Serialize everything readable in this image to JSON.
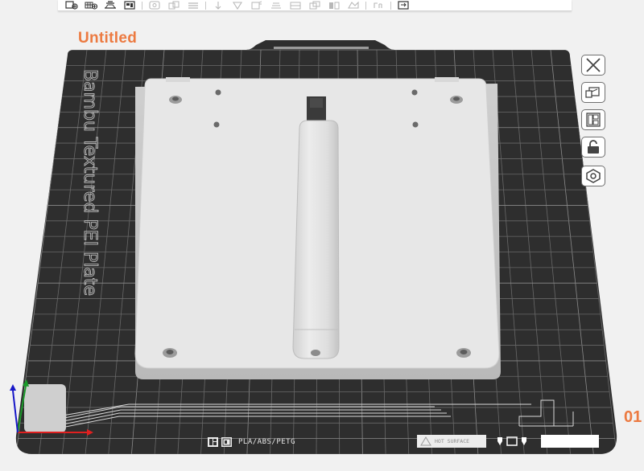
{
  "toolbar": {
    "buttons": [
      {
        "name": "add-object-icon",
        "enabled": true
      },
      {
        "name": "add-plate-icon",
        "enabled": true
      },
      {
        "name": "auto-orient-icon",
        "enabled": true
      },
      {
        "name": "arrange-icon",
        "enabled": true
      },
      {
        "name": "split-objects-icon",
        "enabled": false
      },
      {
        "name": "split-parts-icon",
        "enabled": false
      },
      {
        "name": "layers-icon",
        "enabled": false
      },
      {
        "name": "move-icon",
        "enabled": false
      },
      {
        "name": "rotate-icon",
        "enabled": false
      },
      {
        "name": "scale-icon",
        "enabled": false
      },
      {
        "name": "lay-on-face-icon",
        "enabled": false
      },
      {
        "name": "cut-icon",
        "enabled": false
      },
      {
        "name": "mesh-boolean-icon",
        "enabled": false
      },
      {
        "name": "support-paint-icon",
        "enabled": false
      },
      {
        "name": "seam-paint-icon",
        "enabled": false
      },
      {
        "name": "text-emboss-icon",
        "enabled": false
      },
      {
        "name": "assembly-view-icon",
        "enabled": true
      }
    ]
  },
  "project": {
    "title": "Untitled"
  },
  "plate": {
    "texture_label": "Bambu Textured PEI Plate",
    "filament_types": "PLA/ABS/PETG",
    "hot_surface_text": "HOT SURFACE",
    "number": "01"
  },
  "plate_tools": [
    {
      "name": "remove-plate-icon"
    },
    {
      "name": "pick-plate-icon"
    },
    {
      "name": "arrange-plate-icon"
    },
    {
      "name": "lock-plate-icon"
    },
    {
      "name": "plate-settings-icon"
    }
  ],
  "colors": {
    "accent": "#ec7a41",
    "plate_bg": "#2e2e2e",
    "grid_line": "#6a6a6a",
    "model": "#e6e6e6",
    "axis_x": "#e02020",
    "axis_y": "#1a9a2a",
    "axis_z": "#1818c8"
  }
}
